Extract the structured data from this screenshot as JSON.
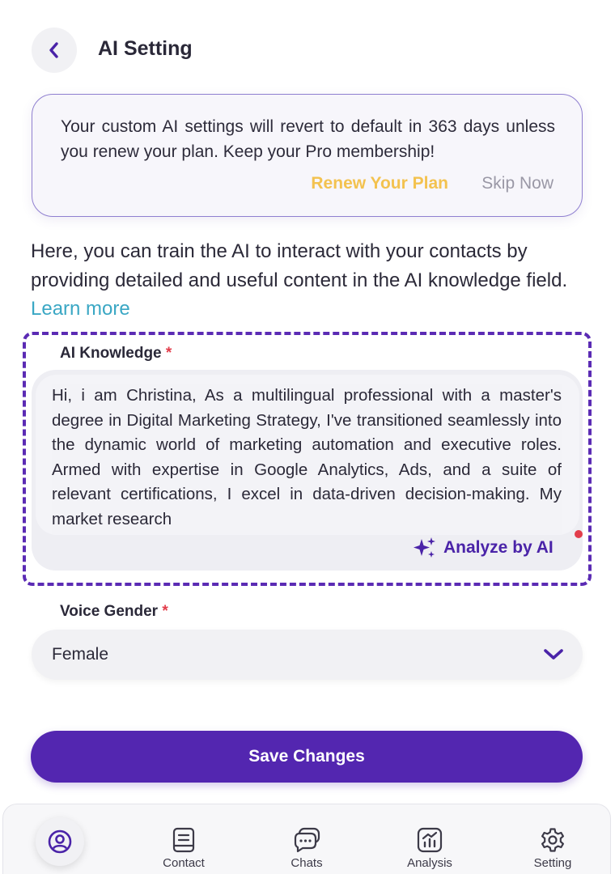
{
  "header": {
    "title": "AI Setting",
    "back_icon": "chevron-left-icon"
  },
  "notice": {
    "message": "Your custom AI settings will revert to default in 363 days unless you renew your plan. Keep your Pro membership!",
    "renew_label": "Renew Your Plan",
    "skip_label": "Skip Now"
  },
  "intro": {
    "text": "Here, you can train the AI to interact with your contacts by providing detailed and useful content in the AI knowledge field.",
    "learn_more": "Learn more"
  },
  "knowledge": {
    "label": "AI Knowledge",
    "required_mark": "*",
    "value": "Hi, i am Christina, As a multilingual professional with a master's degree in Digital Marketing Strategy, I've transitioned seamlessly into the dynamic world of marketing automation and executive roles. Armed with expertise in Google Analytics, Ads, and a suite of relevant certifications, I excel in data-driven decision-making. My market research",
    "analyze_label": "Analyze by AI",
    "analyze_icon": "sparkle-icon"
  },
  "voice_gender": {
    "label": "Voice Gender",
    "required_mark": "*",
    "selected": "Female",
    "icon": "chevron-down-icon"
  },
  "save": {
    "label": "Save Changes"
  },
  "bottom_nav": {
    "items": [
      {
        "label": "Contact",
        "icon": "contact-book-icon"
      },
      {
        "label": "Chats",
        "icon": "chat-bubbles-icon"
      },
      {
        "label": "Analysis",
        "icon": "analysis-chart-icon"
      },
      {
        "label": "Setting",
        "icon": "gear-icon"
      }
    ],
    "profile_icon": "user-avatar-icon"
  },
  "colors": {
    "primary": "#5326b0",
    "accent_yellow": "#f3c24f",
    "link_teal": "#3aa7c4",
    "required_red": "#e23d4b"
  }
}
